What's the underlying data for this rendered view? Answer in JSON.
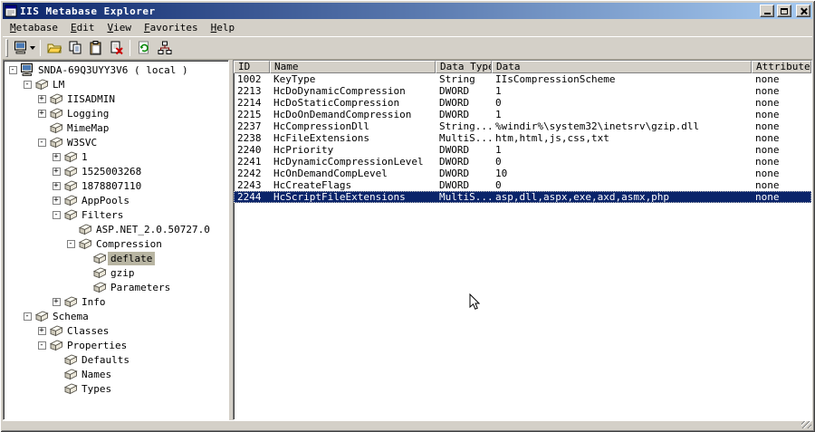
{
  "window": {
    "title": "IIS Metabase Explorer",
    "control_icons": [
      "minimize-icon",
      "maximize-icon",
      "close-icon"
    ]
  },
  "menu": [
    {
      "label": "Metabase",
      "accel_index": 0
    },
    {
      "label": "Edit",
      "accel_index": 0
    },
    {
      "label": "View",
      "accel_index": 0
    },
    {
      "label": "Favorites",
      "accel_index": 0
    },
    {
      "label": "Help",
      "accel_index": 0
    }
  ],
  "toolbar": [
    {
      "icon": "connect-computer-icon",
      "dropdown": true
    },
    {
      "separator": true
    },
    {
      "icon": "open-folder-icon"
    },
    {
      "icon": "copy-icon"
    },
    {
      "icon": "paste-icon"
    },
    {
      "icon": "delete-icon"
    },
    {
      "separator": true
    },
    {
      "icon": "refresh-icon"
    },
    {
      "icon": "network-icon"
    }
  ],
  "tree": {
    "items": [
      {
        "label": "SNDA-69Q3UYY3V6 ( local )",
        "level": 0,
        "expander": "minus",
        "icon": "computer",
        "selected": false
      },
      {
        "label": "LM",
        "level": 1,
        "expander": "minus",
        "icon": "node",
        "selected": false
      },
      {
        "label": "IISADMIN",
        "level": 2,
        "expander": "plus",
        "icon": "node",
        "selected": false
      },
      {
        "label": "Logging",
        "level": 2,
        "expander": "plus",
        "icon": "node",
        "selected": false
      },
      {
        "label": "MimeMap",
        "level": 2,
        "expander": "none",
        "icon": "node",
        "selected": false
      },
      {
        "label": "W3SVC",
        "level": 2,
        "expander": "minus",
        "icon": "node",
        "selected": false
      },
      {
        "label": "1",
        "level": 3,
        "expander": "plus",
        "icon": "node",
        "selected": false
      },
      {
        "label": "1525003268",
        "level": 3,
        "expander": "plus",
        "icon": "node",
        "selected": false
      },
      {
        "label": "1878807110",
        "level": 3,
        "expander": "plus",
        "icon": "node",
        "selected": false
      },
      {
        "label": "AppPools",
        "level": 3,
        "expander": "plus",
        "icon": "node",
        "selected": false
      },
      {
        "label": "Filters",
        "level": 3,
        "expander": "minus",
        "icon": "node",
        "selected": false
      },
      {
        "label": "ASP.NET_2.0.50727.0",
        "level": 4,
        "expander": "none",
        "icon": "node",
        "selected": false
      },
      {
        "label": "Compression",
        "level": 4,
        "expander": "minus",
        "icon": "node",
        "selected": false
      },
      {
        "label": "deflate",
        "level": 5,
        "expander": "none",
        "icon": "node",
        "selected": true
      },
      {
        "label": "gzip",
        "level": 5,
        "expander": "none",
        "icon": "node",
        "selected": false
      },
      {
        "label": "Parameters",
        "level": 5,
        "expander": "none",
        "icon": "node",
        "selected": false
      },
      {
        "label": "Info",
        "level": 3,
        "expander": "plus",
        "icon": "node",
        "selected": false
      },
      {
        "label": "Schema",
        "level": 1,
        "expander": "minus",
        "icon": "node",
        "selected": false
      },
      {
        "label": "Classes",
        "level": 2,
        "expander": "plus",
        "icon": "node",
        "selected": false
      },
      {
        "label": "Properties",
        "level": 2,
        "expander": "minus",
        "icon": "node",
        "selected": false
      },
      {
        "label": "Defaults",
        "level": 3,
        "expander": "none",
        "icon": "node",
        "selected": false
      },
      {
        "label": "Names",
        "level": 3,
        "expander": "none",
        "icon": "node",
        "selected": false
      },
      {
        "label": "Types",
        "level": 3,
        "expander": "none",
        "icon": "node",
        "selected": false
      }
    ]
  },
  "table": {
    "columns": [
      "ID",
      "Name",
      "Data Type",
      "Data",
      "Attributes"
    ],
    "rows": [
      [
        "1002",
        "KeyType",
        "String",
        "IIsCompressionScheme",
        "none"
      ],
      [
        "2213",
        "HcDoDynamicCompression",
        "DWORD",
        "1",
        "none"
      ],
      [
        "2214",
        "HcDoStaticCompression",
        "DWORD",
        "0",
        "none"
      ],
      [
        "2215",
        "HcDoOnDemandCompression",
        "DWORD",
        "1",
        "none"
      ],
      [
        "2237",
        "HcCompressionDll",
        "String...",
        "%windir%\\system32\\inetsrv\\gzip.dll",
        "none"
      ],
      [
        "2238",
        "HcFileExtensions",
        "MultiS...",
        "htm,html,js,css,txt",
        "none"
      ],
      [
        "2240",
        "HcPriority",
        "DWORD",
        "1",
        "none"
      ],
      [
        "2241",
        "HcDynamicCompressionLevel",
        "DWORD",
        "0",
        "none"
      ],
      [
        "2242",
        "HcOnDemandCompLevel",
        "DWORD",
        "10",
        "none"
      ],
      [
        "2243",
        "HcCreateFlags",
        "DWORD",
        "0",
        "none"
      ],
      [
        "2244",
        "HcScriptFileExtensions",
        "MultiS...",
        "asp,dll,aspx,exe,axd,asmx,php",
        "none"
      ]
    ],
    "selected_row_index": 10
  },
  "colors": {
    "chrome": "#d4d0c8",
    "titlebar_start": "#0a246a",
    "titlebar_end": "#a6caf0",
    "selection": "#0a246a",
    "selection_text": "#ffffff",
    "tree_inactive_selection": "#b8b5a2"
  }
}
